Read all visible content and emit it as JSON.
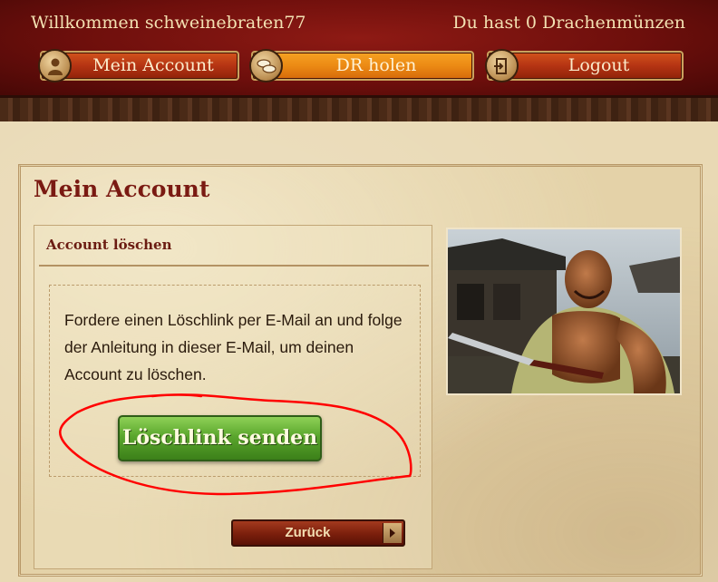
{
  "header": {
    "welcome": "Willkommen schweinebraten77",
    "coins": "Du hast 0 Drachenmünzen",
    "nav": [
      {
        "label": "Mein Account",
        "icon": "user-icon"
      },
      {
        "label": "DR holen",
        "icon": "coins-icon"
      },
      {
        "label": "Logout",
        "icon": "door-exit-icon"
      }
    ]
  },
  "page": {
    "title": "Mein Account",
    "section_title": "Account löschen",
    "instructions": "Fordere einen Löschlink per E-Mail an und folge der Anleitung in dieser E-Mail, um deinen Account zu löschen.",
    "send_button": "Löschlink senden",
    "back_button": "Zurück",
    "back_icon": "chevron-right-icon"
  },
  "colors": {
    "header_red": "#6e0f0c",
    "nav_button": "#b53413",
    "nav_active": "#ec8a14",
    "title_red": "#7a1a12",
    "send_green": "#5aa62d",
    "annotation_red": "#ff0000"
  }
}
